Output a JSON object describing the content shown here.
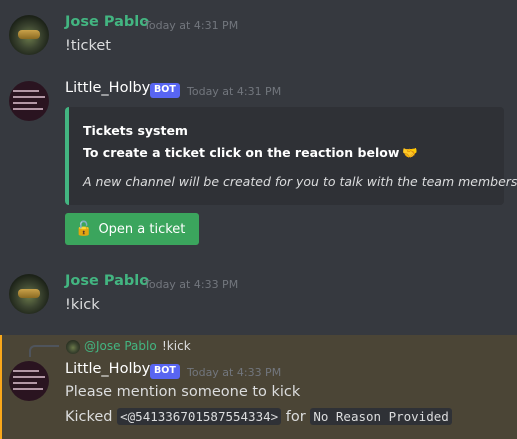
{
  "messages": [
    {
      "author": "Jose Pablo",
      "time": "Today at 4:31 PM",
      "content": "!ticket"
    },
    {
      "author": "Little_Holby",
      "bot_tag": "BOT",
      "time": "Today at 4:31 PM",
      "embed": {
        "title": "Tickets system",
        "description": "To create a ticket click on the reaction below",
        "description_emoji": "🤝",
        "footer": "A new channel will be created for you to talk with the team members !",
        "accent_color": "#43b581"
      },
      "button": {
        "emoji": "🔓",
        "label": "Open a ticket",
        "color": "#3ba55d"
      }
    },
    {
      "author": "Jose Pablo",
      "time": "Today at 4:33 PM",
      "content": "!kick"
    },
    {
      "reply": {
        "author": "@Jose Pablo",
        "content": "!kick"
      },
      "author": "Little_Holby",
      "bot_tag": "BOT",
      "time": "Today at 4:33 PM",
      "content": "Please mention someone to kick",
      "line2": {
        "prefix": "Kicked",
        "user_code": "<@541336701587554334>",
        "middle": "for",
        "reason_code": "No Reason Provided"
      }
    }
  ],
  "colors": {
    "background": "#36393f",
    "highlight": "#4b4536",
    "username_green": "#43b581",
    "bot_tag": "#5865f2"
  }
}
